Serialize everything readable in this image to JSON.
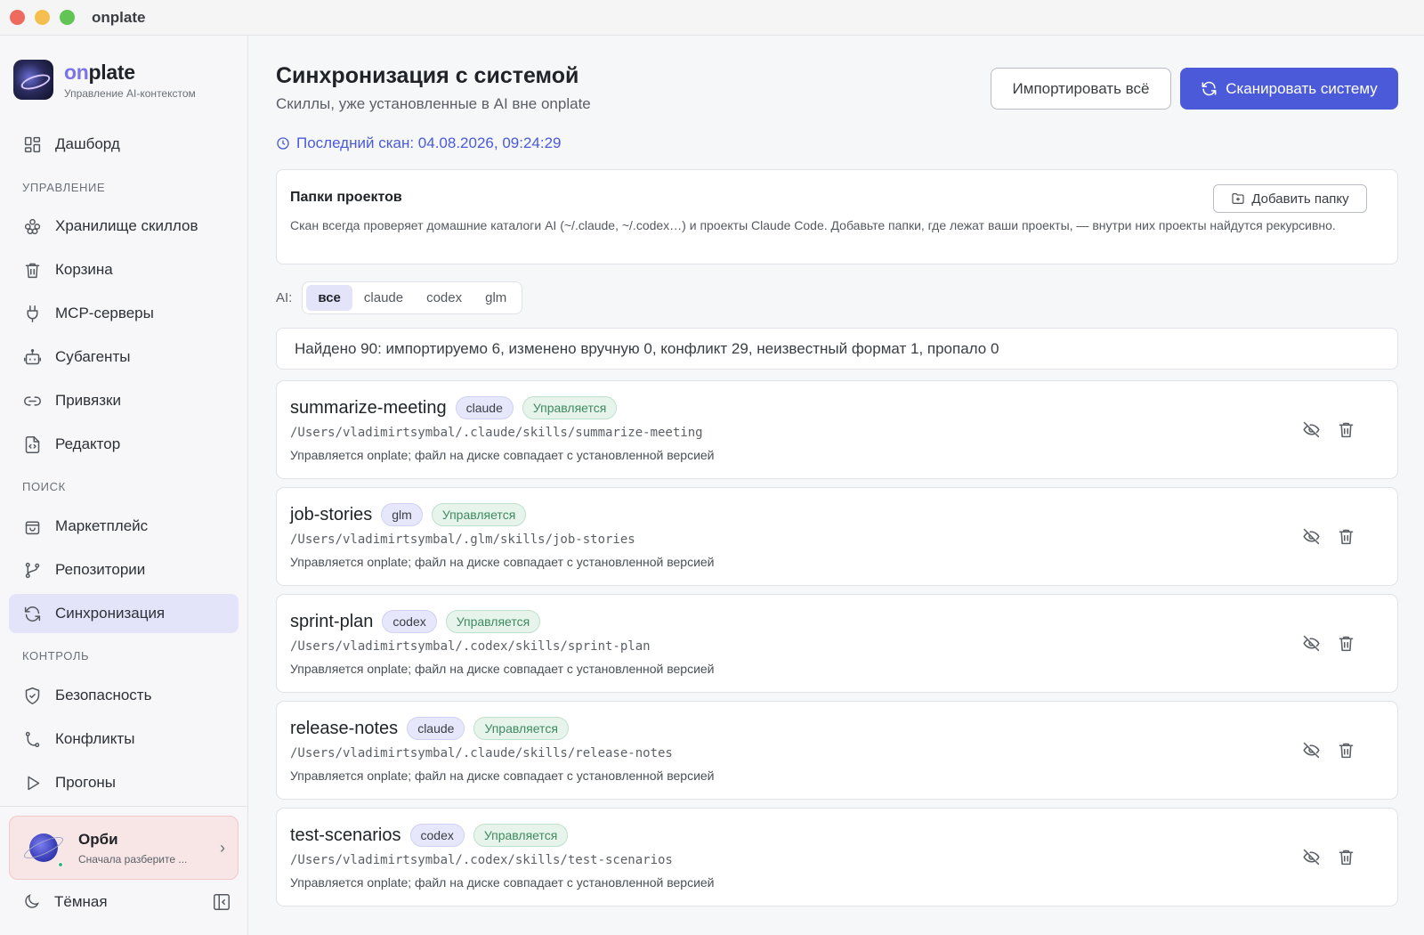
{
  "window": {
    "title": "onplate"
  },
  "brand": {
    "name_prefix": "on",
    "name_suffix": "plate",
    "subtitle": "Управление AI-контекстом"
  },
  "sidebar": {
    "dashboard": "Дашборд",
    "sections": {
      "manage": "УПРАВЛЕНИЕ",
      "search": "ПОИСК",
      "control": "КОНТРОЛЬ"
    },
    "items": [
      {
        "label": "Хранилище скиллов",
        "icon": "skills-vault-icon"
      },
      {
        "label": "Корзина",
        "icon": "trash-icon"
      },
      {
        "label": "MCP-серверы",
        "icon": "plug-icon"
      },
      {
        "label": "Субагенты",
        "icon": "bot-icon"
      },
      {
        "label": "Привязки",
        "icon": "link-icon"
      },
      {
        "label": "Редактор",
        "icon": "file-code-icon"
      },
      {
        "label": "Маркетплейс",
        "icon": "shopping-bag-icon"
      },
      {
        "label": "Репозитории",
        "icon": "git-branch-icon"
      },
      {
        "label": "Синхронизация",
        "icon": "sync-icon",
        "active": true
      },
      {
        "label": "Безопасность",
        "icon": "shield-check-icon"
      },
      {
        "label": "Конфликты",
        "icon": "git-merge-icon"
      },
      {
        "label": "Прогоны",
        "icon": "play-icon"
      }
    ],
    "assistant": {
      "name": "Орби",
      "message": "Сначала разберите ..."
    },
    "theme_label": "Тёмная"
  },
  "main": {
    "title": "Синхронизация с системой",
    "subtitle": "Скиллы, уже установленные в AI вне onplate",
    "import_all": "Импортировать всё",
    "scan_system": "Сканировать систему",
    "last_scan": "Последний скан: 04.08.2026, 09:24:29",
    "folders": {
      "title": "Папки проектов",
      "add_button": "Добавить папку",
      "description": "Скан всегда проверяет домашние каталоги AI (~/.claude, ~/.codex…) и проекты Claude Code. Добавьте папки, где лежат ваши проекты, — внутри них проекты найдутся рекурсивно."
    },
    "ai_filter": {
      "label": "AI:",
      "options": [
        "все",
        "claude",
        "codex",
        "glm"
      ],
      "selected": "все"
    },
    "summary": "Найдено 90: импортируемо 6, изменено вручную 0, конфликт 29, неизвестный формат 1, пропало 0",
    "skills": [
      {
        "name": "summarize-meeting",
        "ai": "claude",
        "status": "Управляется",
        "path": "/Users/vladimirtsymbal/.claude/skills/summarize-meeting",
        "note": "Управляется onplate; файл на диске совпадает с установленной версией"
      },
      {
        "name": "job-stories",
        "ai": "glm",
        "status": "Управляется",
        "path": "/Users/vladimirtsymbal/.glm/skills/job-stories",
        "note": "Управляется onplate; файл на диске совпадает с установленной версией"
      },
      {
        "name": "sprint-plan",
        "ai": "codex",
        "status": "Управляется",
        "path": "/Users/vladimirtsymbal/.codex/skills/sprint-plan",
        "note": "Управляется onplate; файл на диске совпадает с установленной версией"
      },
      {
        "name": "release-notes",
        "ai": "claude",
        "status": "Управляется",
        "path": "/Users/vladimirtsymbal/.claude/skills/release-notes",
        "note": "Управляется onplate; файл на диске совпадает с установленной версией"
      },
      {
        "name": "test-scenarios",
        "ai": "codex",
        "status": "Управляется",
        "path": "/Users/vladimirtsymbal/.codex/skills/test-scenarios",
        "note": "Управляется onplate; файл на диске совпадает с установленной версией"
      }
    ]
  },
  "colors": {
    "accent": "#4a5ad8",
    "active_nav": "#e3e4fa",
    "managed_badge": "#3f8a5e"
  }
}
